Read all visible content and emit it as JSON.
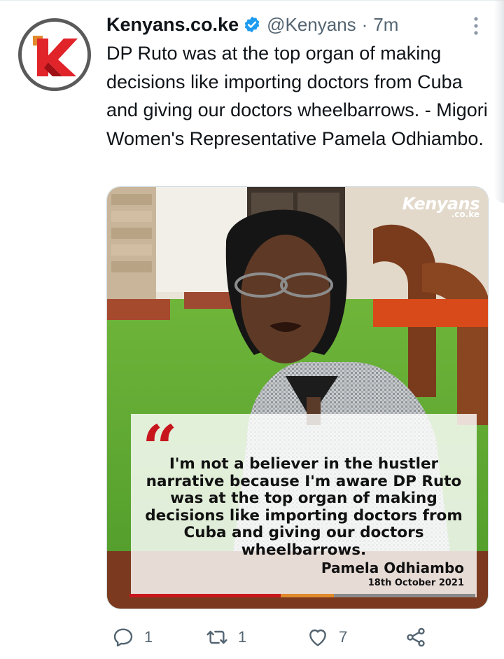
{
  "tweet": {
    "author_name": "Kenyans.co.ke",
    "handle": "@Kenyans",
    "separator": "·",
    "time": "7m",
    "text": "DP Ruto was at the top organ of making decisions like importing doctors from Cuba and giving our doctors wheelbarrows. - Migori Women's Representative Pamela Odhiambo."
  },
  "media": {
    "brand_main": "Kenyans",
    "brand_sub": ".co.ke",
    "quote_mark": "“",
    "quote": "I'm not a believer in the hustler narrative because I'm aware DP Ruto was at the top organ of making decisions like importing doctors from Cuba and giving our doctors wheelbarrows.",
    "quote_author": "Pamela Odhiambo",
    "quote_date": "18th October 2021",
    "bar_colors": [
      "#c8161d",
      "#e08a2c",
      "#8a8a8a"
    ]
  },
  "actions": {
    "reply_count": "1",
    "retweet_count": "1",
    "like_count": "7"
  },
  "colors": {
    "text_primary": "#0f1419",
    "text_secondary": "#536471",
    "verified_blue": "#1d9bf0",
    "brand_red": "#c8161d"
  },
  "icons": [
    "verified-badge-icon",
    "more-options-icon",
    "reply-icon",
    "retweet-icon",
    "like-icon",
    "share-icon"
  ]
}
